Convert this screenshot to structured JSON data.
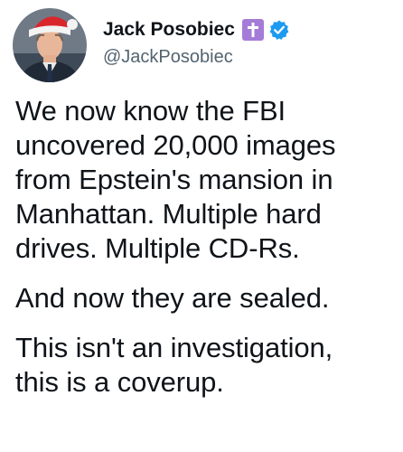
{
  "tweet": {
    "author": {
      "display_name": "Jack Posobiec",
      "handle": "@JackPosobiec",
      "badge_icon": "cross-icon",
      "verified_icon": "verified-check-icon",
      "colors": {
        "badge_background": "#a57bd8",
        "verified": "#1d9bf0",
        "handle": "#536471"
      }
    },
    "paragraphs": [
      "We now know the FBI\nuncovered 20,000 images\nfrom Epstein's mansion in\nManhattan. Multiple hard\ndrives. Multiple CD-Rs.",
      "And now they are sealed.",
      "This isn't an investigation,\nthis is a coverup."
    ]
  }
}
